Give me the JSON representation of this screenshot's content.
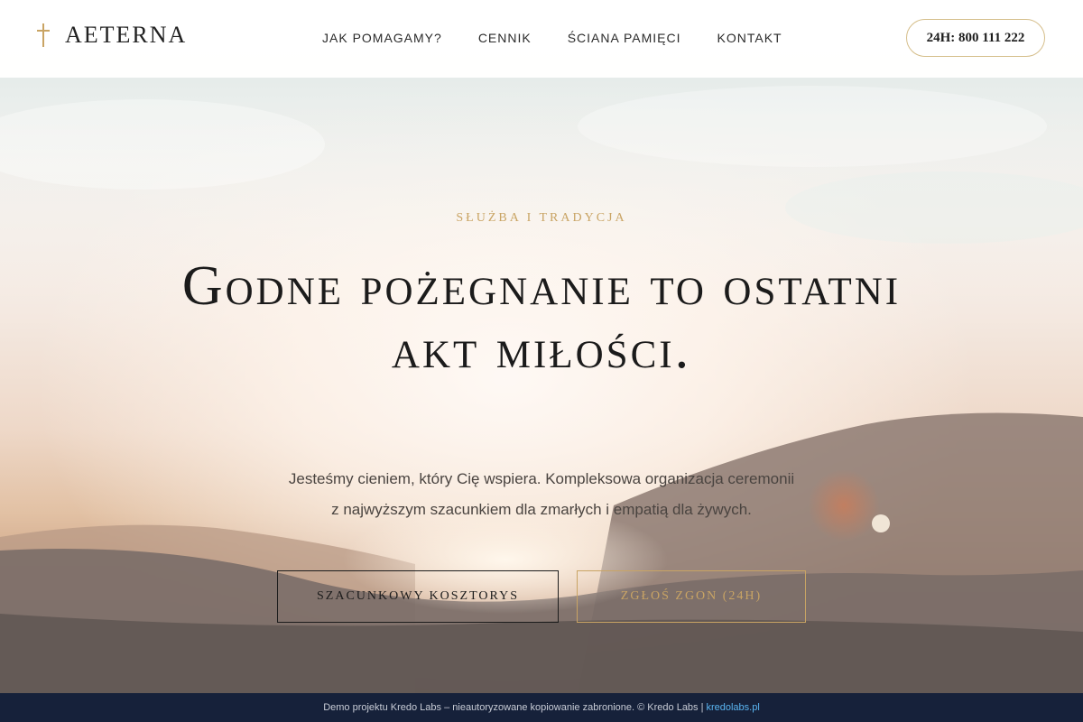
{
  "brand": {
    "name": "AETERNA",
    "icon": "cross-icon",
    "accent_color": "#c9a464"
  },
  "nav": {
    "items": [
      {
        "label": "JAK POMAGAMY?"
      },
      {
        "label": "CENNIK"
      },
      {
        "label": "ŚCIANA PAMIĘCI"
      },
      {
        "label": "KONTAKT"
      }
    ],
    "phone_label": "24H: 800 111 222"
  },
  "hero": {
    "eyebrow": "SŁUŻBA I TRADYCJA",
    "headline": "Godne pożegnanie to ostatni akt miłości.",
    "lead_line1": "Jesteśmy cieniem, który Cię wspiera. Kompleksowa organizacja ceremonii",
    "lead_line2": "z najwyższym szacunkiem dla zmarłych i empatią dla żywych.",
    "primary_button": "SZACUNKOWY KOSZTORYS",
    "secondary_button": "ZGŁOŚ ZGON (24H)"
  },
  "footer": {
    "text": "Demo projektu Kredo Labs – nieautoryzowane kopiowanie zabronione. © Kredo Labs |",
    "link_label": "kredolabs.pl"
  }
}
